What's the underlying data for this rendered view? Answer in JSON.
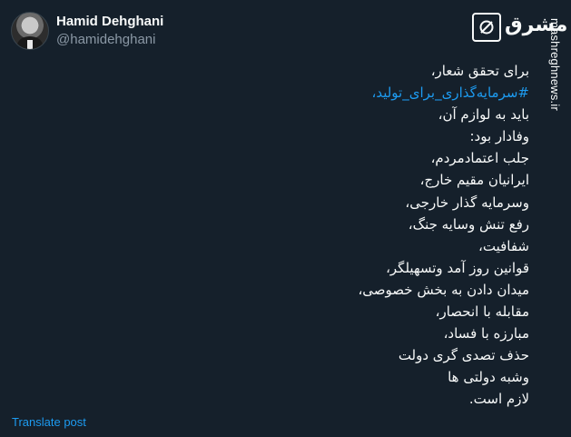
{
  "author": {
    "display_name": "Hamid Dehghani",
    "handle": "@hamidehghani"
  },
  "tweet": {
    "lines": [
      "برای تحقق شعار،",
      "#سرمایه‌گذاری_برای_تولید،",
      "باید به لوازم آن،",
      "وفادار بود:",
      "جلب اعتمادمردم،",
      "ایرانیان مقیم خارج،",
      "وسرمایه گذار خارجی،",
      "رفع تنش وسایه جنگ،",
      "شفافیت،",
      "قوانین روز آمد وتسهیلگر،",
      "میدان دادن به بخش خصوصی،",
      "مقابله با انحصار،",
      "مبارزه با فساد،",
      "حذف تصدی گری دولت",
      "وشبه دولتی ها",
      "لازم است."
    ],
    "translate_label": "Translate post"
  },
  "watermark": {
    "brand_word": "مشرق",
    "site": "mashreghnews.ir",
    "icon": "mashregh-logo-icon"
  },
  "colors": {
    "background": "#15202b",
    "text": "#f7f9f9",
    "secondary": "#8b98a5",
    "accent": "#1d9bf0"
  }
}
